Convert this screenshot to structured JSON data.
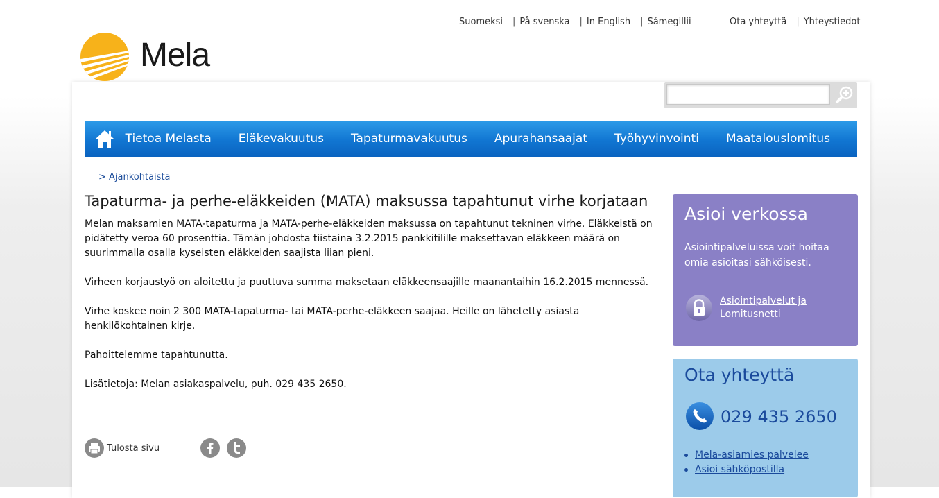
{
  "language_links": [
    "Suomeksi",
    "På svenska",
    "In English",
    "Sámegillii"
  ],
  "contact_links": [
    "Ota yhteyttä",
    "Yhteystiedot"
  ],
  "logo": {
    "text": "Mela"
  },
  "search": {
    "value": "",
    "placeholder": ""
  },
  "nav": {
    "items": [
      "Tietoa Melasta",
      "Eläkevakuutus",
      "Tapaturmavakuutus",
      "Apurahansaajat",
      "Työhyvinvointi",
      "Maatalouslomitus"
    ]
  },
  "breadcrumb": "> Ajankohtaista",
  "article": {
    "title": "Tapaturma- ja perhe-eläkkeiden (MATA) maksussa tapahtunut virhe korjataan",
    "paragraphs": [
      "Melan maksamien MATA-tapaturma ja MATA-perhe-eläkkeiden maksussa on tapahtunut tekninen virhe. Eläkkeistä on pidätetty veroa 60 prosenttia. Tämän johdosta tiistaina 3.2.2015 pankkitilille maksettavan eläkkeen määrä on suurimmalla osalla kyseisten eläkkeiden saajista liian pieni.",
      "Virheen korjaustyö on aloitettu ja puuttuva summa maksetaan eläkkeensaajille maanantaihin 16.2.2015 mennessä.",
      "Virhe koskee noin 2 300 MATA-tapaturma- tai MATA-perhe-eläkkeen saajaa. Heille on lähetetty asiasta henkilökohtainen kirje.",
      "Pahoittelemme tapahtunutta.",
      "Lisätietoja: Melan asiakaspalvelu, puh. 029 435 2650."
    ]
  },
  "tools": {
    "print_label": "Tulosta sivu"
  },
  "sidebar": {
    "online": {
      "title": "Asioi verkossa",
      "description": "Asiointipalveluissa voit hoitaa omia asioitasi sähköisesti.",
      "link": "Asiointipalvelut ja Lomitusnetti"
    },
    "contact": {
      "title": "Ota yhteyttä",
      "phone": "029 435 2650",
      "links": [
        "Mela-asiamies palvelee",
        "Asioi sähköpostilla"
      ]
    }
  },
  "colors": {
    "nav_blue": "#1176d2",
    "logo_orange": "#f7b21a",
    "sidebar_purple": "#8a80c6",
    "sidebar_blue": "#9ccbea"
  }
}
